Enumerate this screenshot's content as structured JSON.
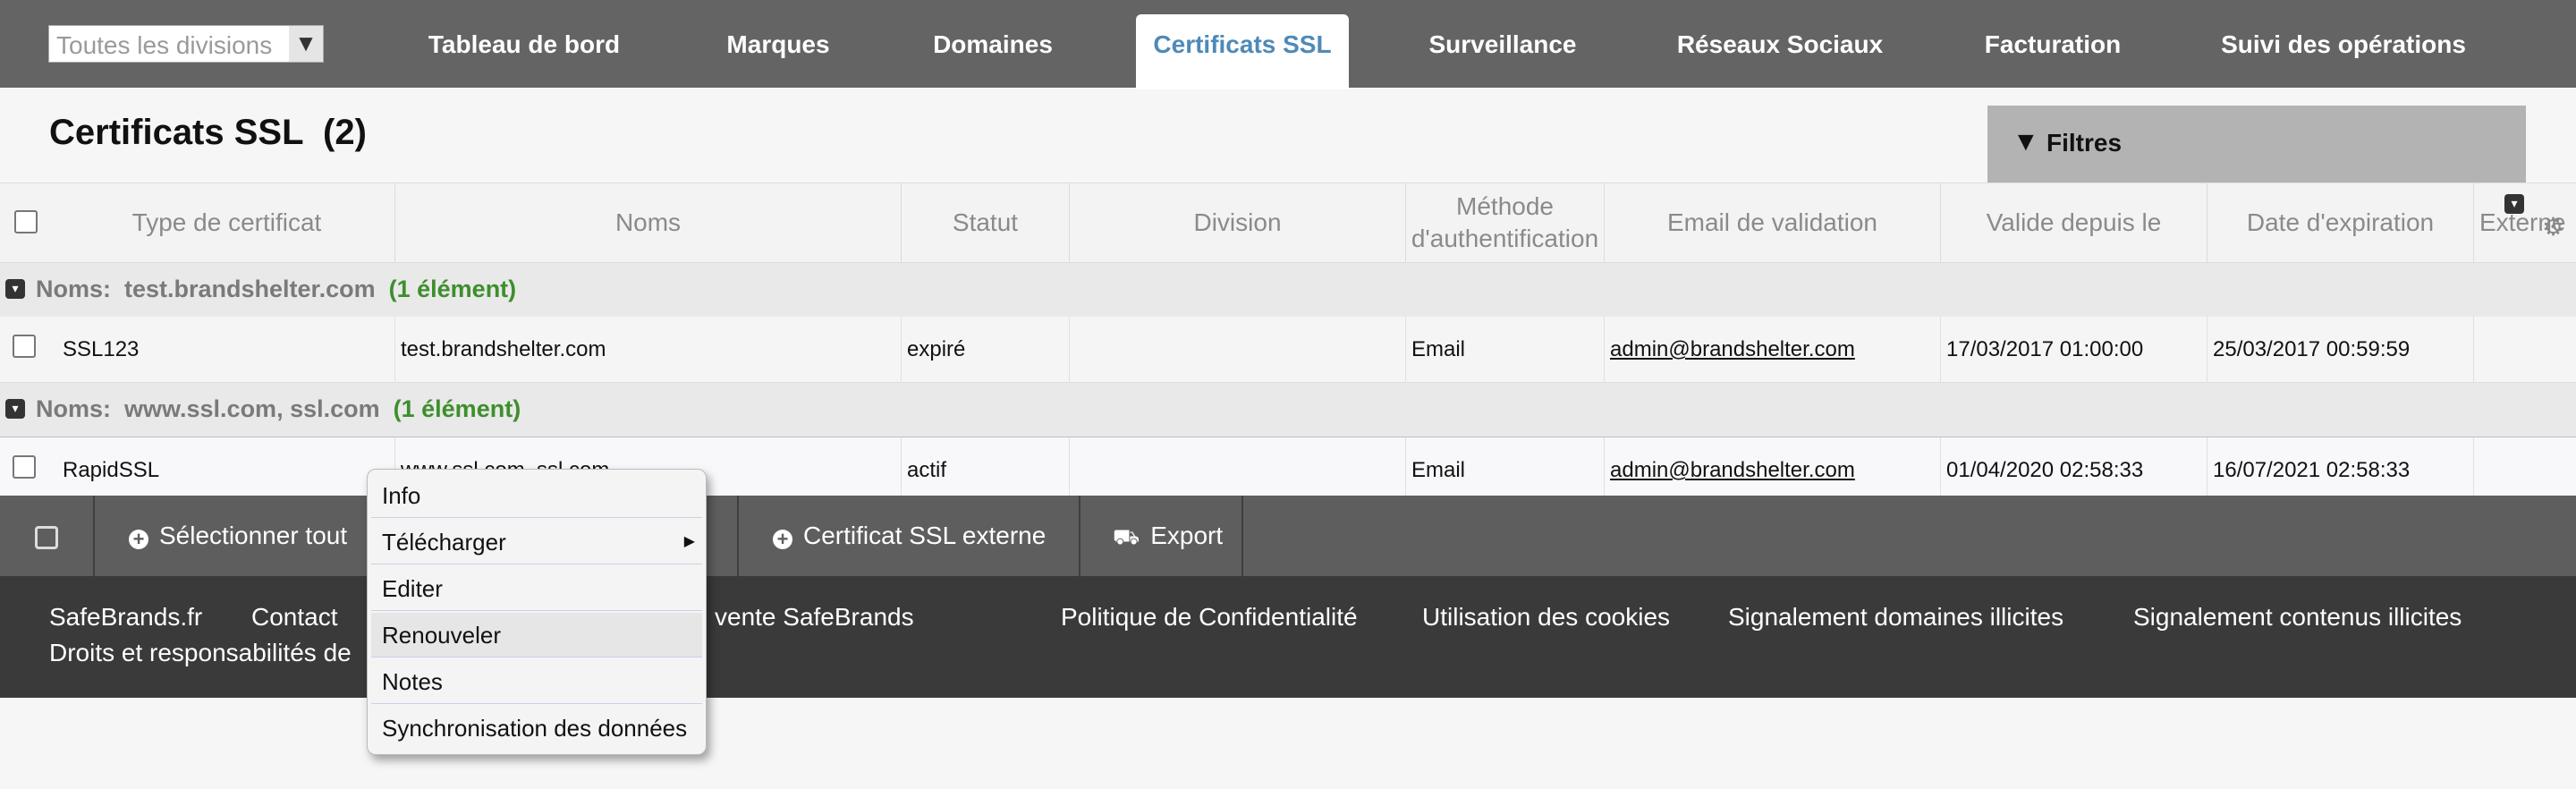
{
  "nav": {
    "division_placeholder": "Toutes les divisions",
    "items": [
      {
        "label": "Tableau de bord"
      },
      {
        "label": "Marques"
      },
      {
        "label": "Domaines"
      },
      {
        "label": "Certificats SSL"
      },
      {
        "label": "Surveillance"
      },
      {
        "label": "Réseaux Sociaux"
      },
      {
        "label": "Facturation"
      },
      {
        "label": "Suivi des opérations"
      }
    ],
    "active": "Certificats SSL"
  },
  "page": {
    "title": "Certificats SSL",
    "count": "(2)",
    "filters_label": "Filtres"
  },
  "table": {
    "columns": [
      "Type de certificat",
      "Noms",
      "Statut",
      "Division",
      "Méthode d'authentification",
      "Email de validation",
      "Valide depuis le",
      "Date d'expiration",
      "Externe"
    ],
    "groups": [
      {
        "label": "Noms:  test.brandshelter.com",
        "count": "(1 élément)",
        "row": {
          "type": "SSL123",
          "names": "test.brandshelter.com",
          "status": "expiré",
          "division": "",
          "method": "Email",
          "email": "admin@brandshelter.com",
          "valid_from": "17/03/2017 01:00:00",
          "expires": "25/03/2017 00:59:59",
          "external": ""
        }
      },
      {
        "label": "Noms:  www.ssl.com, ssl.com",
        "count": "(1 élément)",
        "row": {
          "type": "RapidSSL",
          "names": "www.ssl.com, ssl.com",
          "status": "actif",
          "division": "",
          "method": "Email",
          "email": "admin@brandshelter.com",
          "valid_from": "01/04/2020 02:58:33",
          "expires": "16/07/2021 02:58:33",
          "external": ""
        }
      }
    ]
  },
  "actions": {
    "select_all": "Sélectionner tout",
    "external_ssl": "Certificat SSL externe",
    "export": "Export"
  },
  "footer": {
    "links": [
      "SafeBrands.fr",
      "Contact",
      "Conditions de vente SafeBrands",
      "Politique de Confidentialité",
      "Utilisation des cookies",
      "Signalement domaines illicites",
      "Signalement contenus illicites",
      "Droits et responsabilités de"
    ]
  },
  "context_menu": {
    "items": [
      "Info",
      "Télécharger",
      "Editer",
      "Renouveler",
      "Notes",
      "Synchronisation des données"
    ],
    "highlighted": "Renouveler"
  },
  "colors": {
    "nav_bg": "#646464",
    "active_tab_text": "#4e8ab7",
    "group_count": "#3e8e2d",
    "footer_bg": "#3a3a3a"
  }
}
